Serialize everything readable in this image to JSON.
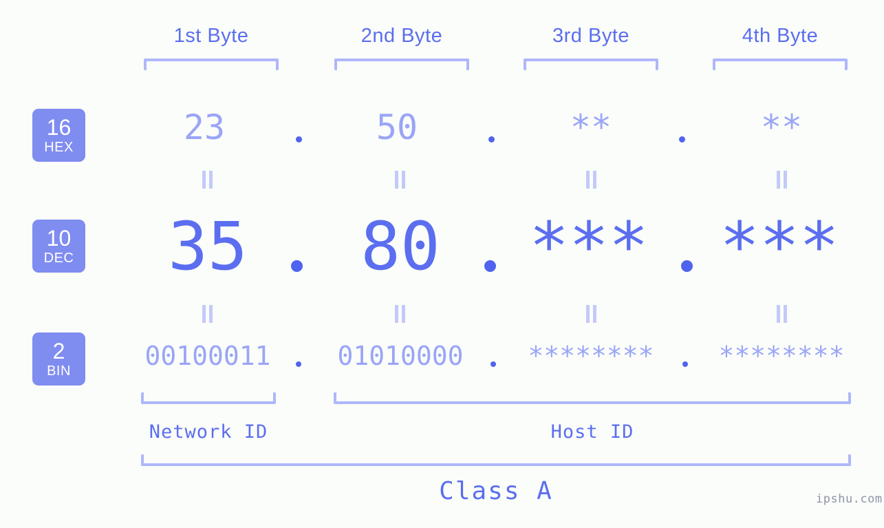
{
  "page": {
    "background_color": "#fbfdfa",
    "accent_color": "#5b6ef0",
    "muted_color": "#9aa5f7",
    "bracket_color": "#aeb7fb",
    "badge_color": "#7f8cf0",
    "watermark": "ipshu.com"
  },
  "columns": [
    {
      "header": "1st Byte"
    },
    {
      "header": "2nd Byte"
    },
    {
      "header": "3rd Byte"
    },
    {
      "header": "4th Byte"
    }
  ],
  "rows": {
    "hex": {
      "badge_number": "16",
      "badge_label": "HEX",
      "values": [
        "23",
        "50",
        "**",
        "**"
      ],
      "separator": "."
    },
    "dec": {
      "badge_number": "10",
      "badge_label": "DEC",
      "values": [
        "35",
        "80",
        "***",
        "***"
      ],
      "separator": "."
    },
    "bin": {
      "badge_number": "2",
      "badge_label": "BIN",
      "values": [
        "00100011",
        "01010000",
        "********",
        "********"
      ],
      "separator": "."
    }
  },
  "equals_marks": {
    "symbol": "=",
    "count_per_row": 4,
    "rows": 2
  },
  "segments": {
    "network_id": "Network ID",
    "host_id": "Host ID",
    "class": "Class A"
  }
}
